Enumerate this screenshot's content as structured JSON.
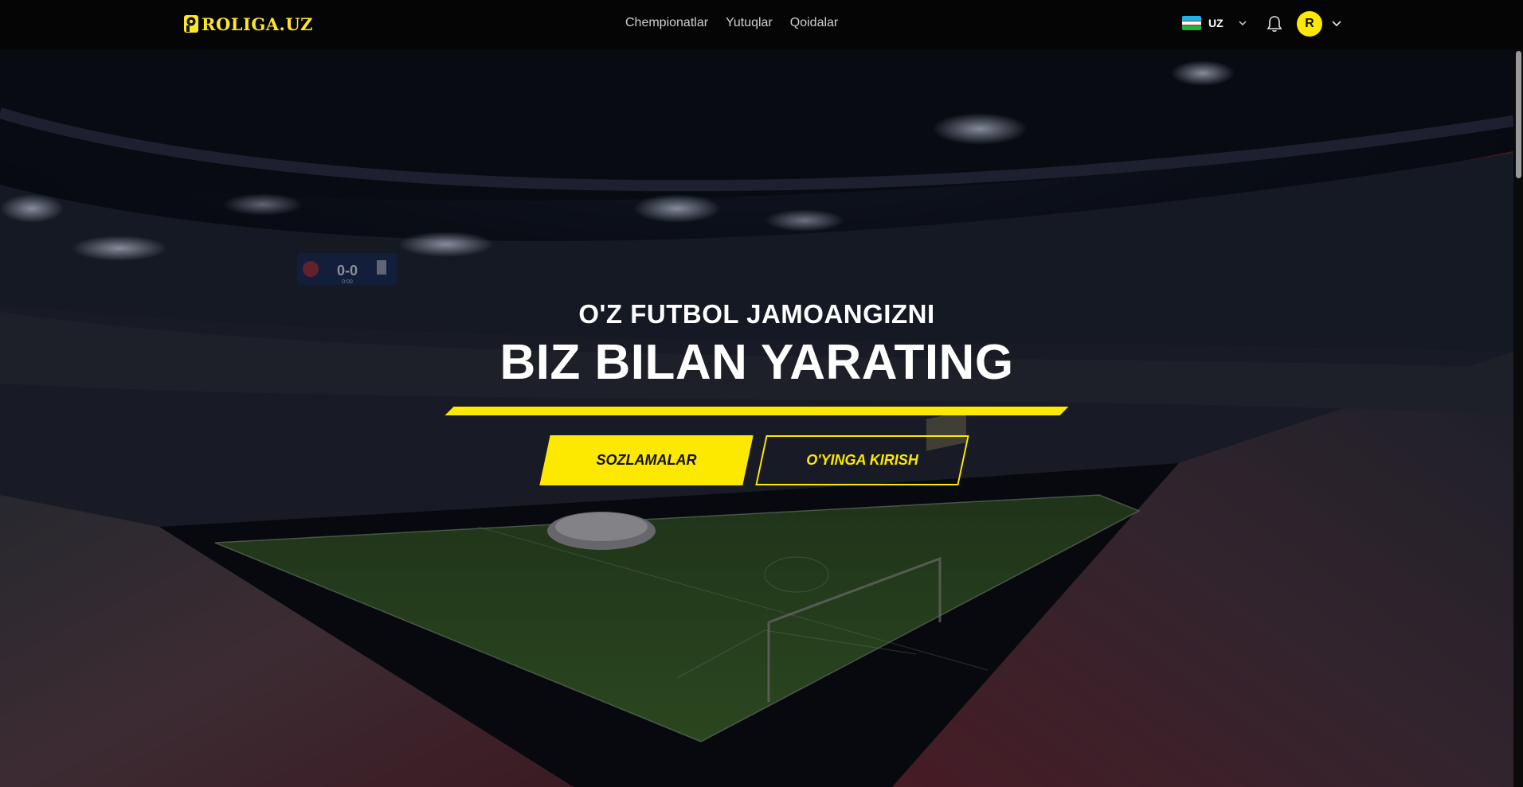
{
  "header": {
    "logo_text": "ROLIGA.UZ",
    "nav": [
      {
        "label": "Chempionatlar"
      },
      {
        "label": "Yutuqlar"
      },
      {
        "label": "Qoidalar"
      }
    ],
    "language": {
      "code": "UZ",
      "flag": "uzbekistan-flag-icon"
    },
    "user": {
      "initial": "R"
    }
  },
  "hero": {
    "subtitle": "O'Z FUTBOL JAMOANGIZNI",
    "title": "BIZ BILAN YARATING",
    "primary_button": "SOZLAMALAR",
    "secondary_button": "O'YINGA KIRISH",
    "scoreboard": {
      "score": "0-0",
      "clock": "0:00"
    }
  },
  "colors": {
    "accent": "#fde800",
    "header_bg": "#050505",
    "pitch": "#3f6a2a"
  }
}
